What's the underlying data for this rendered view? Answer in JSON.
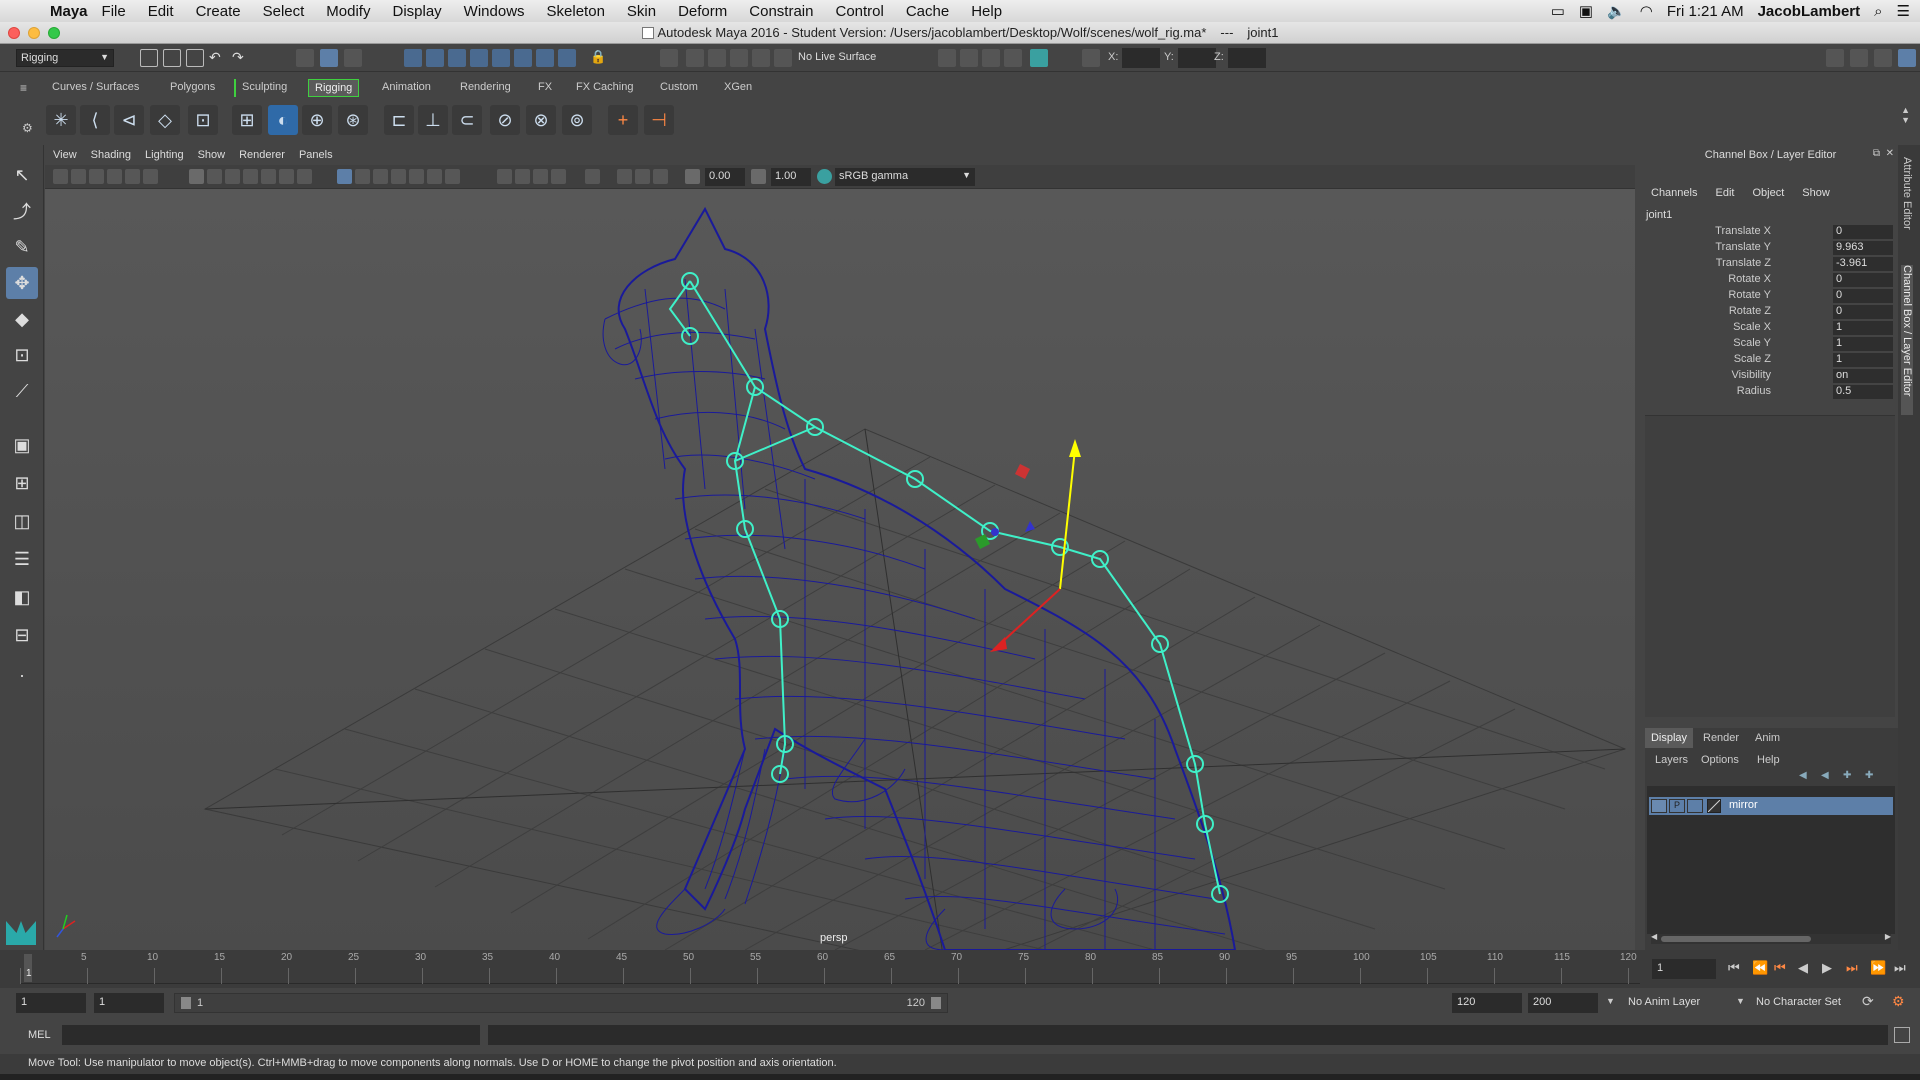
{
  "mac": {
    "app_name": "Maya",
    "menus": [
      "File",
      "Edit",
      "Create",
      "Select",
      "Modify",
      "Display",
      "Windows",
      "Skeleton",
      "Skin",
      "Deform",
      "Constrain",
      "Control",
      "Cache",
      "Help"
    ],
    "clock": "Fri 1:21 AM",
    "user": "JacobLambert"
  },
  "window": {
    "title": "Autodesk Maya 2016 - Student Version: /Users/jacoblambert/Desktop/Wolf/scenes/wolf_rig.ma*",
    "separator": "---",
    "selected_node": "joint1"
  },
  "status_line": {
    "menu_set": "Rigging",
    "live_surface": "No Live Surface",
    "x_label": "X:",
    "y_label": "Y:",
    "z_label": "Z:"
  },
  "shelf": {
    "tabs": [
      "Curves / Surfaces",
      "Polygons",
      "Sculpting",
      "Rigging",
      "Animation",
      "Rendering",
      "FX",
      "FX Caching",
      "Custom",
      "XGen"
    ],
    "active_tab": "Rigging"
  },
  "viewport": {
    "menus": [
      "View",
      "Shading",
      "Lighting",
      "Show",
      "Renderer",
      "Panels"
    ],
    "exposure": "0.00",
    "gamma": "1.00",
    "color_space": "sRGB gamma",
    "camera_label": "persp"
  },
  "channel_box": {
    "header": "Channel Box / Layer Editor",
    "menus": [
      "Channels",
      "Edit",
      "Object",
      "Show"
    ],
    "node": "joint1",
    "attributes": [
      {
        "name": "Translate X",
        "value": "0"
      },
      {
        "name": "Translate Y",
        "value": "9.963"
      },
      {
        "name": "Translate Z",
        "value": "-3.961"
      },
      {
        "name": "Rotate X",
        "value": "0"
      },
      {
        "name": "Rotate Y",
        "value": "0"
      },
      {
        "name": "Rotate Z",
        "value": "0"
      },
      {
        "name": "Scale X",
        "value": "1"
      },
      {
        "name": "Scale Y",
        "value": "1"
      },
      {
        "name": "Scale Z",
        "value": "1"
      },
      {
        "name": "Visibility",
        "value": "on"
      },
      {
        "name": "Radius",
        "value": "0.5"
      }
    ]
  },
  "layer_editor": {
    "tabs": [
      "Display",
      "Render",
      "Anim"
    ],
    "active_tab": "Display",
    "menus": [
      "Layers",
      "Options",
      "Help"
    ],
    "layer_p": "P",
    "layer_name": "mirror"
  },
  "side_tabs": [
    "Attribute Editor",
    "Channel Box / Layer Editor"
  ],
  "timeline": {
    "ticks": [
      "5",
      "10",
      "15",
      "20",
      "25",
      "30",
      "35",
      "40",
      "45",
      "50",
      "55",
      "60",
      "65",
      "70",
      "75",
      "80",
      "85",
      "90",
      "95",
      "100",
      "105",
      "110",
      "115",
      "120"
    ],
    "current_frame_marker": "1",
    "current_frame": "1"
  },
  "range": {
    "start": "1",
    "playback_start": "1",
    "slider_start": "1",
    "slider_end": "120",
    "playback_end": "120",
    "end": "200",
    "anim_layer": "No Anim Layer",
    "character_set": "No Character Set"
  },
  "command": {
    "lang": "MEL"
  },
  "help_line": "Move Tool: Use manipulator to move object(s). Ctrl+MMB+drag to move components along normals. Use D or HOME to change the pivot position and axis orientation.",
  "colors": {
    "accent_green": "#3fd03f",
    "wire_blue": "#1a1a9a",
    "joint_cyan": "#3ff0c8",
    "selection_blue": "#5d7fa8"
  }
}
